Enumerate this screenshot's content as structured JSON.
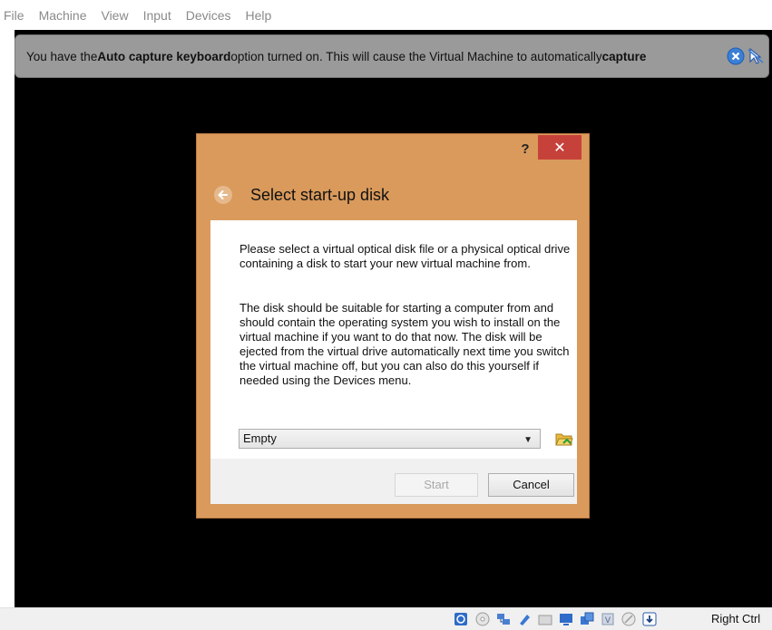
{
  "menubar": {
    "items": [
      "File",
      "Machine",
      "View",
      "Input",
      "Devices",
      "Help"
    ]
  },
  "notice": {
    "text_1": "You have the ",
    "bold_1": "Auto capture keyboard",
    "text_2": " option turned on. This will cause the Virtual Machine to automatically ",
    "bold_2": "capture"
  },
  "dialog": {
    "help": "?",
    "close": "✕",
    "title": "Select start-up disk",
    "paragraph_1": "Please select a virtual optical disk file or a physical optical drive containing a disk to start your new virtual machine from.",
    "paragraph_2": "The disk should be suitable for starting a computer from and should contain the operating system you wish to install on the virtual machine if you want to do that now. The disk will be ejected from the virtual drive automatically next time you switch the virtual machine off, but you can also do this yourself if needed using the Devices menu.",
    "disk_selected": "Empty",
    "start_label": "Start",
    "cancel_label": "Cancel"
  },
  "statusbar": {
    "host_key": "Right Ctrl"
  },
  "colors": {
    "dialog_frame": "#d99a5c",
    "close_red": "#c7413b",
    "notice_bg": "#9a9a9a",
    "screen_bg": "#000000"
  }
}
